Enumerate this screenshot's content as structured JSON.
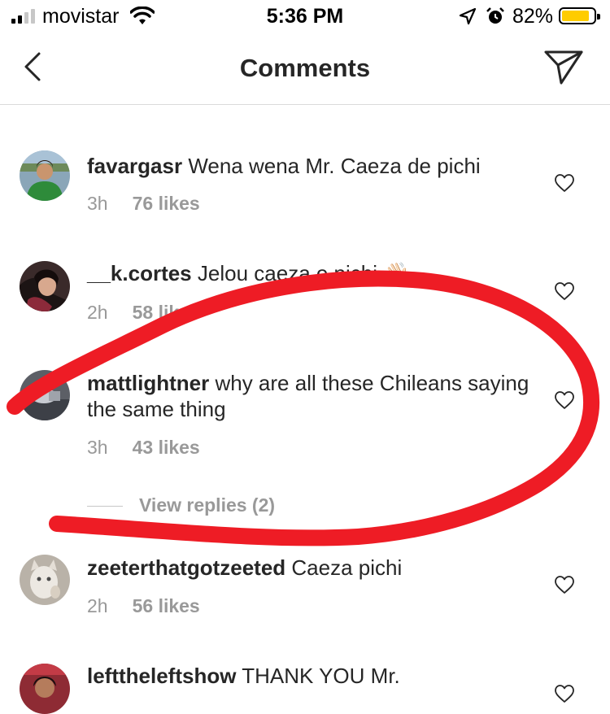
{
  "status_bar": {
    "carrier": "movistar",
    "time": "5:36 PM",
    "battery_pct": "82%",
    "battery_color": "#ffcc00"
  },
  "header": {
    "title": "Comments",
    "back_icon": "chevron-left-icon",
    "send_icon": "paper-plane-icon"
  },
  "comments": [
    {
      "user": "favargasr",
      "text": "Wena wena Mr. Caeza de pichi",
      "time": "3h",
      "likes": "76 likes"
    },
    {
      "user": "__k.cortes",
      "text": "Jelou caeza e pichi 👋🏻",
      "time": "2h",
      "likes": "58 likes"
    },
    {
      "user": "mattlightner",
      "text": "why are all these Chileans saying the same thing",
      "time": "3h",
      "likes": "43 likes",
      "view_replies": "View replies (2)"
    },
    {
      "user": "zeeterthatgotzeeted",
      "text": "Caeza pichi",
      "time": "2h",
      "likes": "56 likes"
    },
    {
      "user": "lefttheleftshow",
      "text": "THANK YOU Mr.",
      "time": "",
      "likes": ""
    }
  ],
  "annotation_color": "#ee1c25"
}
